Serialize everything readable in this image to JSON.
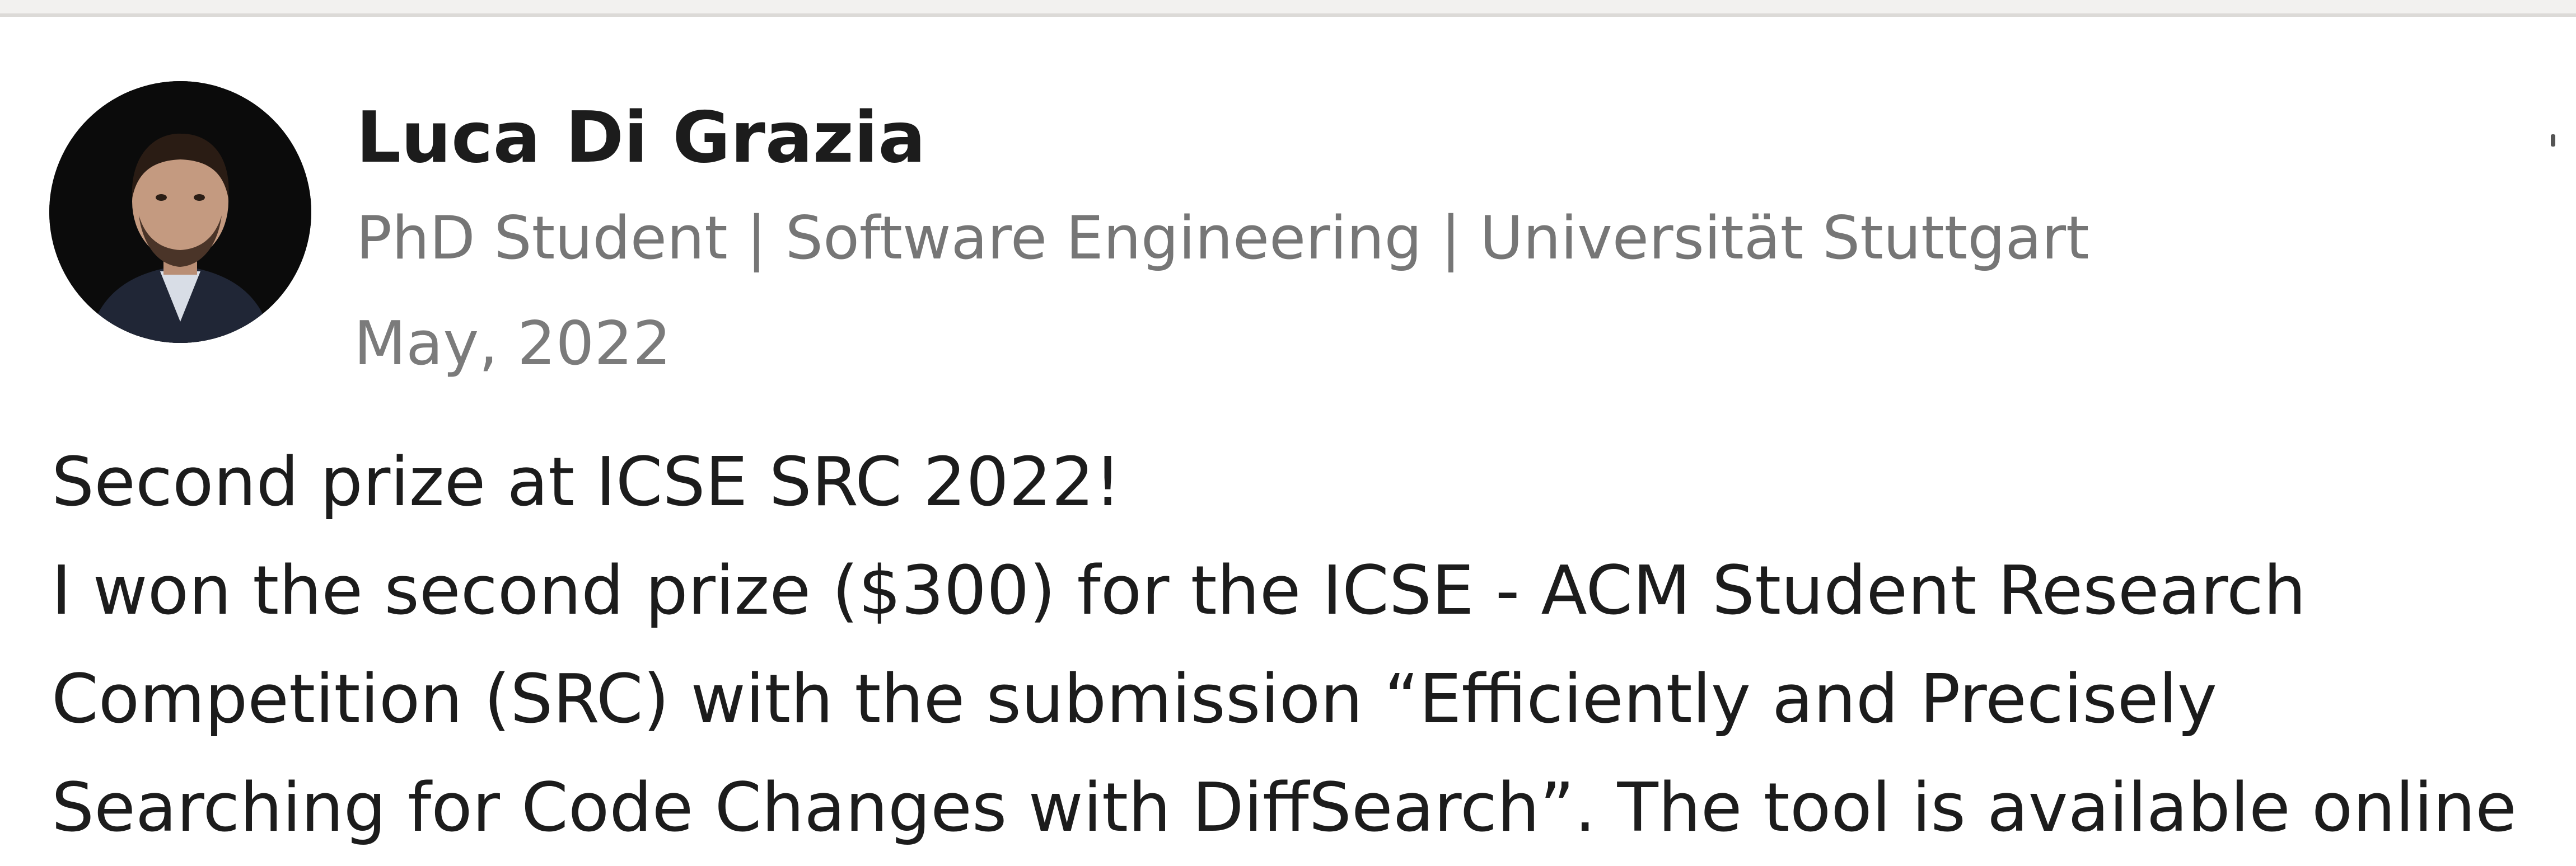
{
  "author": {
    "name": "Luca Di Grazia",
    "headline": "PhD Student | Software Engineering | Universität Stuttgart"
  },
  "post": {
    "date": "May, 2022",
    "title": "Second prize at ICSE SRC 2022!",
    "body_lines": [
      "I won the second prize ($300) for the ICSE - ACM Student Research",
      "Competition (SRC) with the submission “Efficiently and Precisely",
      "Searching for Code Changes with DiffSearch”. The tool is available online"
    ]
  }
}
